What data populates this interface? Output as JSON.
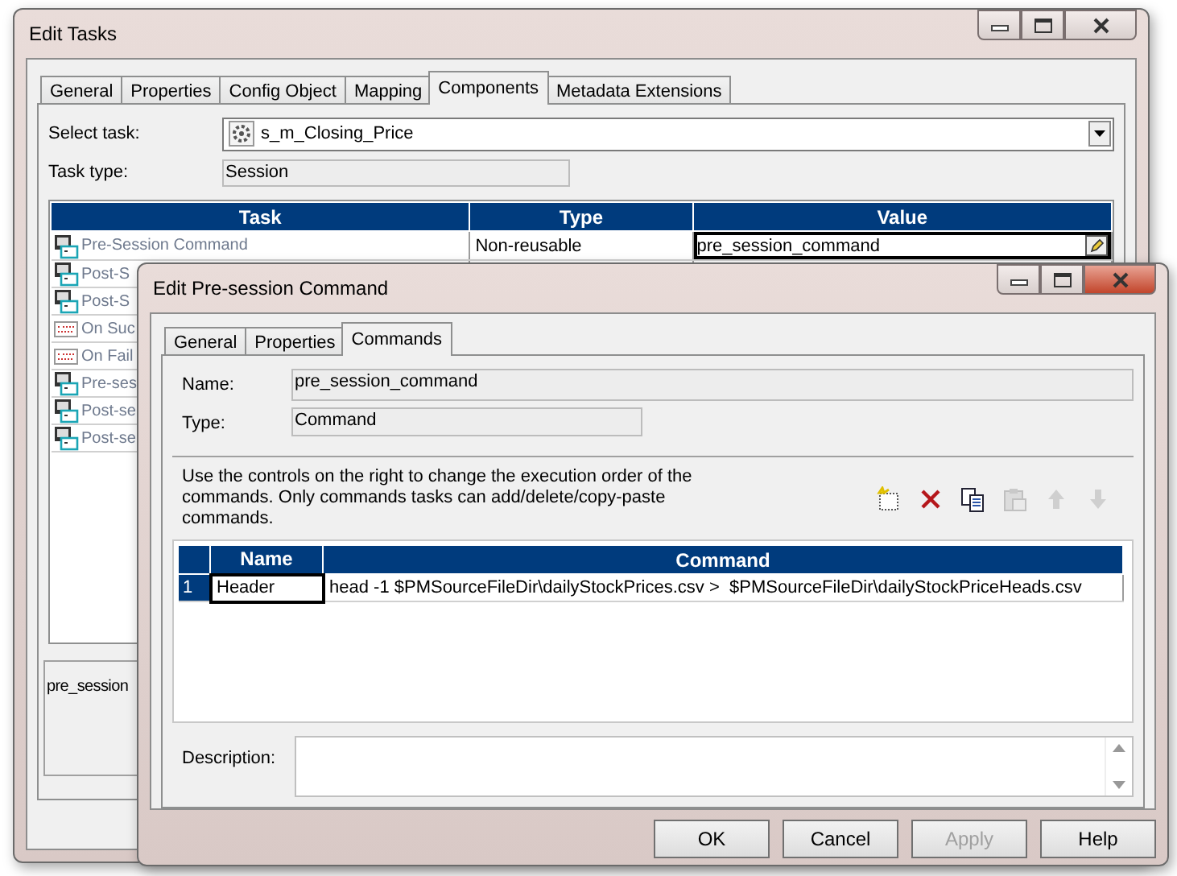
{
  "main_window": {
    "title": "Edit Tasks",
    "tabs": [
      {
        "label": "General",
        "selected": false
      },
      {
        "label": "Properties",
        "selected": false
      },
      {
        "label": "Config Object",
        "selected": false
      },
      {
        "label": "Mapping",
        "selected": false
      },
      {
        "label": "Components",
        "selected": true
      },
      {
        "label": "Metadata Extensions",
        "selected": false
      }
    ],
    "select_task": {
      "label": "Select task:",
      "value": "s_m_Closing_Price"
    },
    "task_type": {
      "label": "Task type:",
      "value": "Session"
    },
    "table": {
      "columns": [
        "Task",
        "Type",
        "Value"
      ],
      "rows": [
        {
          "kind": "command",
          "task": "Pre-Session Command",
          "type": "Non-reusable",
          "value": "pre_session_command",
          "selected": true
        },
        {
          "kind": "command",
          "task": "Post-S",
          "selected": false
        },
        {
          "kind": "command",
          "task": "Post-S",
          "selected": false
        },
        {
          "kind": "email",
          "task": "On Suc",
          "selected": false
        },
        {
          "kind": "email",
          "task": "On Fail",
          "selected": false
        },
        {
          "kind": "command",
          "task": "Pre-ses",
          "selected": false
        },
        {
          "kind": "command",
          "task": "Post-se",
          "selected": false
        },
        {
          "kind": "command",
          "task": "Post-se",
          "selected": false
        }
      ]
    },
    "description_text": "pre_session"
  },
  "dialog": {
    "title": "Edit Pre-session Command",
    "tabs": [
      {
        "label": "General",
        "selected": false
      },
      {
        "label": "Properties",
        "selected": false
      },
      {
        "label": "Commands",
        "selected": true
      }
    ],
    "name": {
      "label": "Name:",
      "value": "pre_session_command"
    },
    "type": {
      "label": "Type:",
      "value": "Command"
    },
    "hint": "Use the controls on the right to change the execution order of the commands.  Only commands tasks can add/delete/copy-paste commands.",
    "toolbar": [
      {
        "kind": "new",
        "disabled": false
      },
      {
        "kind": "delete",
        "disabled": false
      },
      {
        "kind": "copy",
        "disabled": false
      },
      {
        "kind": "paste",
        "disabled": true
      },
      {
        "kind": "up",
        "disabled": true
      },
      {
        "kind": "down",
        "disabled": true
      }
    ],
    "table": {
      "columns": [
        "Name",
        "Command"
      ],
      "rows": [
        {
          "index": "1",
          "name": "Header",
          "command": "head -1 $PMSourceFileDir\\dailyStockPrices.csv >  $PMSourceFileDir\\dailyStockPriceHeads.csv"
        }
      ]
    },
    "description": {
      "label": "Description:"
    },
    "buttons": [
      {
        "label": "OK",
        "disabled": false
      },
      {
        "label": "Cancel",
        "disabled": false
      },
      {
        "label": "Apply",
        "disabled": true
      },
      {
        "label": "Help",
        "disabled": false
      }
    ]
  }
}
